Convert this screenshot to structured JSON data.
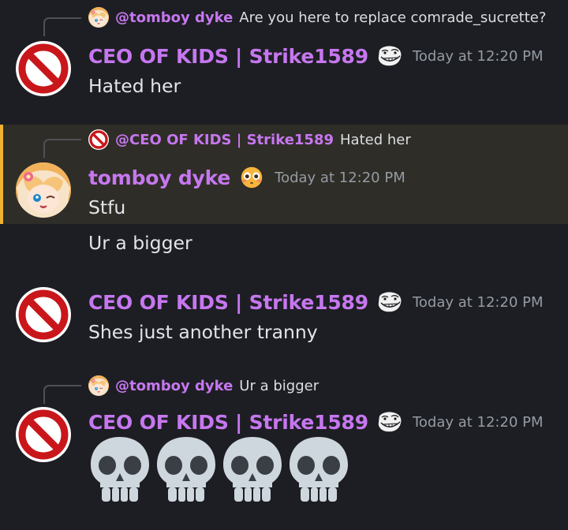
{
  "messages": [
    {
      "reply": {
        "name": "@tomboy dyke",
        "text": "Are you here to replace comrade_sucrette?"
      },
      "username": "CEO OF KIDS | Strike1589",
      "timestamp": "Today at 12:20 PM",
      "text": "Hated her"
    },
    {
      "reply": {
        "name": "@CEO OF KIDS | Strike1589",
        "text": "Hated her"
      },
      "username": "tomboy dyke",
      "timestamp": "Today at 12:20 PM",
      "text": "Stfu",
      "followup": "Ur a bigger",
      "highlighted": true
    },
    {
      "username": "CEO OF KIDS | Strike1589",
      "timestamp": "Today at 12:20 PM",
      "text": "Shes just another tranny"
    },
    {
      "reply": {
        "name": "@tomboy dyke",
        "text": "Ur a bigger"
      },
      "username": "CEO OF KIDS | Strike1589",
      "timestamp": "Today at 12:20 PM",
      "emojis": [
        "skull",
        "skull",
        "skull",
        "skull"
      ]
    }
  ],
  "colors": {
    "background": "#1d1e23",
    "highlight_bg": "#2f2d27",
    "highlight_bar": "#f0b232",
    "username": "#c677f0",
    "timestamp": "#949ba4"
  },
  "icons": {
    "ceo_avatar": "prohibited-sign-icon",
    "tomboy_avatar": "anime-girl-avatar",
    "ceo_badge": "trollface-icon",
    "tomboy_badge": "flushed-face-icon",
    "emoji": "skull-icon"
  }
}
